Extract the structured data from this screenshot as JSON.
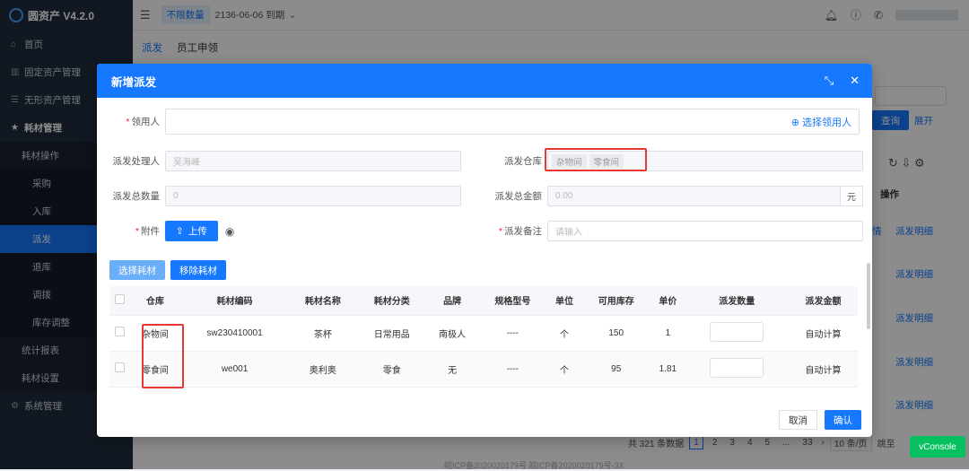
{
  "app": {
    "title": "圆资产 V4.2.0"
  },
  "sidebar": {
    "items": [
      {
        "label": "首页",
        "icon": "home-icon"
      },
      {
        "label": "固定资产管理",
        "icon": "building-icon"
      },
      {
        "label": "无形资产管理",
        "icon": "list-icon"
      },
      {
        "label": "耗材管理",
        "icon": "star-icon"
      },
      {
        "label": "耗材操作"
      },
      {
        "label": "采购"
      },
      {
        "label": "入库"
      },
      {
        "label": "派发"
      },
      {
        "label": "退库"
      },
      {
        "label": "调拨"
      },
      {
        "label": "库存调整"
      },
      {
        "label": "统计报表"
      },
      {
        "label": "耗材设置"
      },
      {
        "label": "系统管理",
        "icon": "gear-icon"
      }
    ]
  },
  "topbar": {
    "plan_tag": "不限数量",
    "expire": "2136-06-06 到期"
  },
  "subtabs": {
    "items": [
      "派发",
      "员工申领"
    ]
  },
  "background": {
    "search_label": "查询",
    "expand_label": "展开",
    "ops_header": "操作",
    "row_links": [
      "派发明细",
      "派发明细",
      "派发明细",
      "派发明细",
      "派发明细",
      "派发明细"
    ],
    "detail_fragment": "情",
    "pager": {
      "total": "共 321 条数据",
      "pages": [
        "1",
        "2",
        "3",
        "4",
        "5",
        "...",
        "33"
      ],
      "page_size": "10 条/页",
      "goto": "跳至"
    },
    "vconsole": "vConsole",
    "icp": "皖ICP备2020020179号  皖ICP备2020020179号-3X"
  },
  "modal": {
    "title": "新增派发",
    "recipient_label": "领用人",
    "select_recipient": "选择领用人",
    "handler_label": "派发处理人",
    "handler_value": "吴海峰",
    "warehouse_label": "派发仓库",
    "warehouse_tags": [
      "杂物间",
      "零食间"
    ],
    "total_qty_label": "派发总数量",
    "total_qty_value": "0",
    "total_amount_label": "派发总金额",
    "total_amount_value": "0.00",
    "currency_unit": "元",
    "attachment_label": "附件",
    "upload_label": "上传",
    "remark_label": "派发备注",
    "remark_placeholder": "请输入",
    "select_material": "选择耗材",
    "remove_material": "移除耗材",
    "table": {
      "headers": [
        "仓库",
        "耗材编码",
        "耗材名称",
        "耗材分类",
        "品牌",
        "规格型号",
        "单位",
        "可用库存",
        "单价",
        "派发数量",
        "派发金额"
      ],
      "rows": [
        {
          "warehouse": "杂物间",
          "code": "sw230410001",
          "name": "茶杯",
          "category": "日常用品",
          "brand": "南极人",
          "spec": "----",
          "unit": "个",
          "stock": "150",
          "price": "1",
          "amount": "自动计算"
        },
        {
          "warehouse": "零食间",
          "code": "we001",
          "name": "奥利奥",
          "category": "零食",
          "brand": "无",
          "spec": "----",
          "unit": "个",
          "stock": "95",
          "price": "1.81",
          "amount": "自动计算"
        }
      ]
    },
    "cancel": "取消",
    "confirm": "确认"
  }
}
